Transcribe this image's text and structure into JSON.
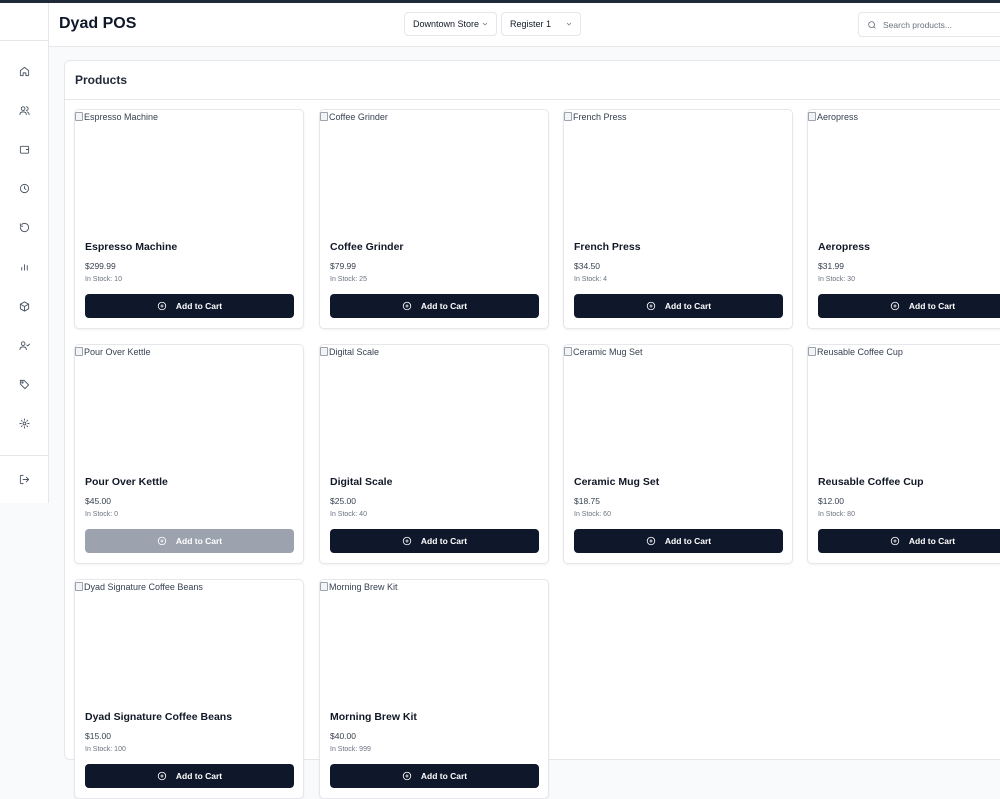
{
  "header": {
    "app_title": "Dyad POS",
    "store_select": "Downtown Store",
    "register_select": "Register 1",
    "search_placeholder": "Search products..."
  },
  "sidebar": {
    "icons": [
      "home-icon",
      "customers-icon",
      "wallet-icon",
      "history-icon",
      "refresh-icon",
      "chart-icon",
      "box-icon",
      "users-icon",
      "tag-icon",
      "settings-icon",
      "logout-icon"
    ]
  },
  "main": {
    "section_title": "Products",
    "add_to_cart_label": "Add to Cart",
    "products": [
      {
        "name": "Espresso Machine",
        "price": "$299.99",
        "stock": "In Stock: 10",
        "available": true
      },
      {
        "name": "Coffee Grinder",
        "price": "$79.99",
        "stock": "In Stock: 25",
        "available": true
      },
      {
        "name": "French Press",
        "price": "$34.50",
        "stock": "In Stock: 4",
        "available": true
      },
      {
        "name": "Aeropress",
        "price": "$31.99",
        "stock": "In Stock: 30",
        "available": true
      },
      {
        "name": "Pour Over Kettle",
        "price": "$45.00",
        "stock": "In Stock: 0",
        "available": false
      },
      {
        "name": "Digital Scale",
        "price": "$25.00",
        "stock": "In Stock: 40",
        "available": true
      },
      {
        "name": "Ceramic Mug Set",
        "price": "$18.75",
        "stock": "In Stock: 60",
        "available": true
      },
      {
        "name": "Reusable Coffee Cup",
        "price": "$12.00",
        "stock": "In Stock: 80",
        "available": true
      },
      {
        "name": "Dyad Signature Coffee Beans",
        "price": "$15.00",
        "stock": "In Stock: 100",
        "available": true
      },
      {
        "name": "Morning Brew Kit",
        "price": "$40.00",
        "stock": "In Stock: 999",
        "available": true
      }
    ]
  },
  "colors": {
    "primary_button": "#0f172a",
    "disabled_button": "#9ca3af",
    "page_background": "#f8fafc"
  }
}
